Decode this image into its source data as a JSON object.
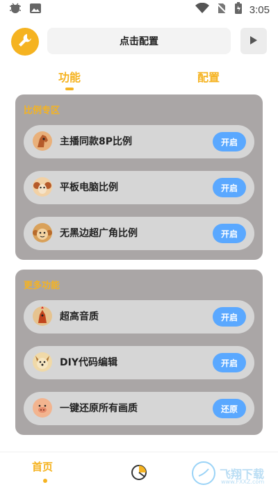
{
  "status": {
    "time": "3:05",
    "icons": [
      "bug-icon",
      "image-icon",
      "wifi-icon",
      "no-sim-icon",
      "battery-icon"
    ]
  },
  "header": {
    "config_button_label": "点击配置",
    "play_icon": "play-icon",
    "accent": "#f5b321"
  },
  "tabs": [
    {
      "label": "功能",
      "active": true
    },
    {
      "label": "配置",
      "active": false
    }
  ],
  "sections": [
    {
      "title": "比例专区",
      "items": [
        {
          "label": "主播同款8P比例",
          "action": "开启",
          "icon": "horse-avatar-icon"
        },
        {
          "label": "平板电脑比例",
          "action": "开启",
          "icon": "ram-avatar-icon"
        },
        {
          "label": "无黑边超广角比例",
          "action": "开启",
          "icon": "monkey-avatar-icon"
        }
      ]
    },
    {
      "title": "更多功能",
      "items": [
        {
          "label": "超高音质",
          "action": "开启",
          "icon": "rooster-avatar-icon"
        },
        {
          "label": "DIY代码编辑",
          "action": "开启",
          "icon": "dog-avatar-icon"
        },
        {
          "label": "一键还原所有画质",
          "action": "还原",
          "icon": "pig-avatar-icon"
        }
      ]
    }
  ],
  "bottom_nav": {
    "home_label": "首页",
    "center_icon": "chart-icon",
    "watermark": {
      "text": "飞翔下载",
      "sub": "www.FXXZ.com"
    }
  },
  "colors": {
    "accent": "#f5b321",
    "button_blue": "#5aa8ff",
    "section_bg": "#aaa6a6",
    "item_bg": "#d6d6d6"
  }
}
